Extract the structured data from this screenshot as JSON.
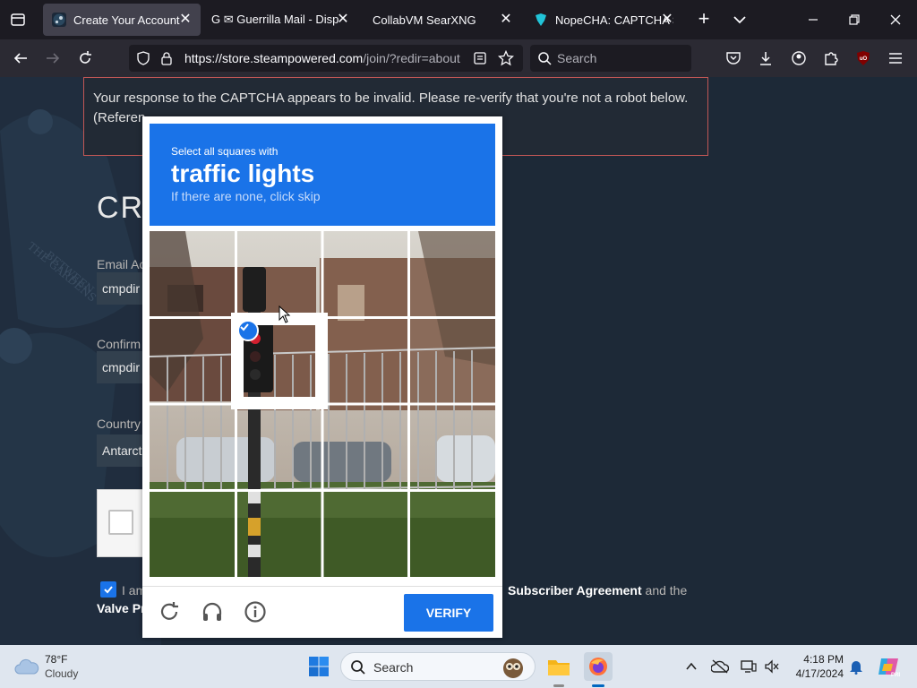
{
  "browser": {
    "tabs": [
      {
        "title": "Create Your Account",
        "favicon": "steam-icon",
        "active": true
      },
      {
        "title": "G ✉ Guerrilla Mail - Disp",
        "favicon": "guerrilla-mail-icon",
        "active": false
      },
      {
        "title": "CollabVM SearXNG",
        "favicon": "",
        "active": false
      },
      {
        "title": "NopeCHA: CAPTCHA S",
        "favicon": "nopecha-icon",
        "active": false
      }
    ],
    "new_tab_symbol": "+",
    "url_host": "https://store.steampowered.com",
    "url_path": "/join/?redir=about",
    "search_placeholder": "Search"
  },
  "page": {
    "error_message": "Your response to the CAPTCHA appears to be invalid. Please re-verify that you're not a robot below.",
    "error_reference": "(Referen",
    "heading": "CR",
    "email_label": "Email Ac",
    "email_value": "cmpdir",
    "confirm_label": "Confirm",
    "confirm_value": "cmpdir",
    "country_label": "Country",
    "country_value": "Antarct",
    "agree_prefix": "I am",
    "agree_link": "Subscriber Agreement",
    "agree_suffix": " and the",
    "agree_link2": "Valve Pr"
  },
  "captcha": {
    "instruction_small": "Select all squares with",
    "instruction_target": "traffic lights",
    "instruction_hint": "If there are none, click skip",
    "verify_label": "VERIFY",
    "selected_tiles": [
      5
    ],
    "icons": [
      "reload-icon",
      "headphones-audio-icon",
      "info-icon"
    ]
  },
  "taskbar": {
    "temperature": "78°F",
    "condition": "Cloudy",
    "search_placeholder": "Search",
    "time": "4:18 PM",
    "date": "4/17/2024"
  },
  "colors": {
    "captcha_blue": "#1a73e8",
    "error_border": "#c15755",
    "browser_dark": "#1c1b22",
    "steam_bg": "#1d2937"
  }
}
